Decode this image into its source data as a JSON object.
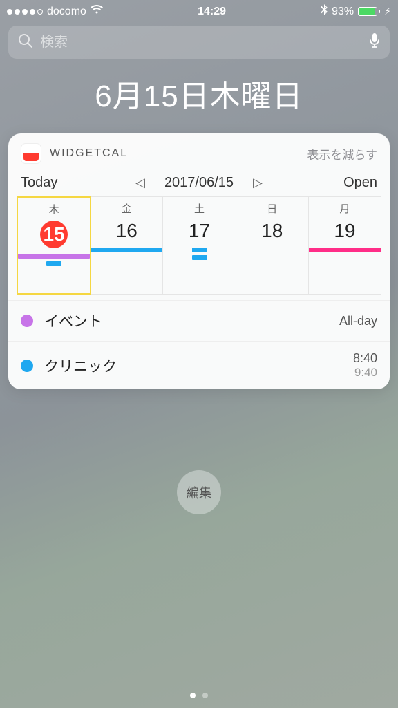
{
  "status": {
    "carrier": "docomo",
    "time": "14:29",
    "battery_pct": "93%"
  },
  "search": {
    "placeholder": "検索"
  },
  "date_heading": "6月15日木曜日",
  "widget": {
    "title": "WIDGETCAL",
    "show_less": "表示を減らす",
    "today_label": "Today",
    "open_label": "Open",
    "current_date": "2017/06/15",
    "days": [
      {
        "dow": "木",
        "num": "15"
      },
      {
        "dow": "金",
        "num": "16"
      },
      {
        "dow": "土",
        "num": "17"
      },
      {
        "dow": "日",
        "num": "18"
      },
      {
        "dow": "月",
        "num": "19"
      }
    ],
    "events": [
      {
        "title": "イベント",
        "time1": "All-day",
        "time2": ""
      },
      {
        "title": "クリニック",
        "time1": "8:40",
        "time2": "9:40"
      }
    ]
  },
  "edit_label": "編集"
}
